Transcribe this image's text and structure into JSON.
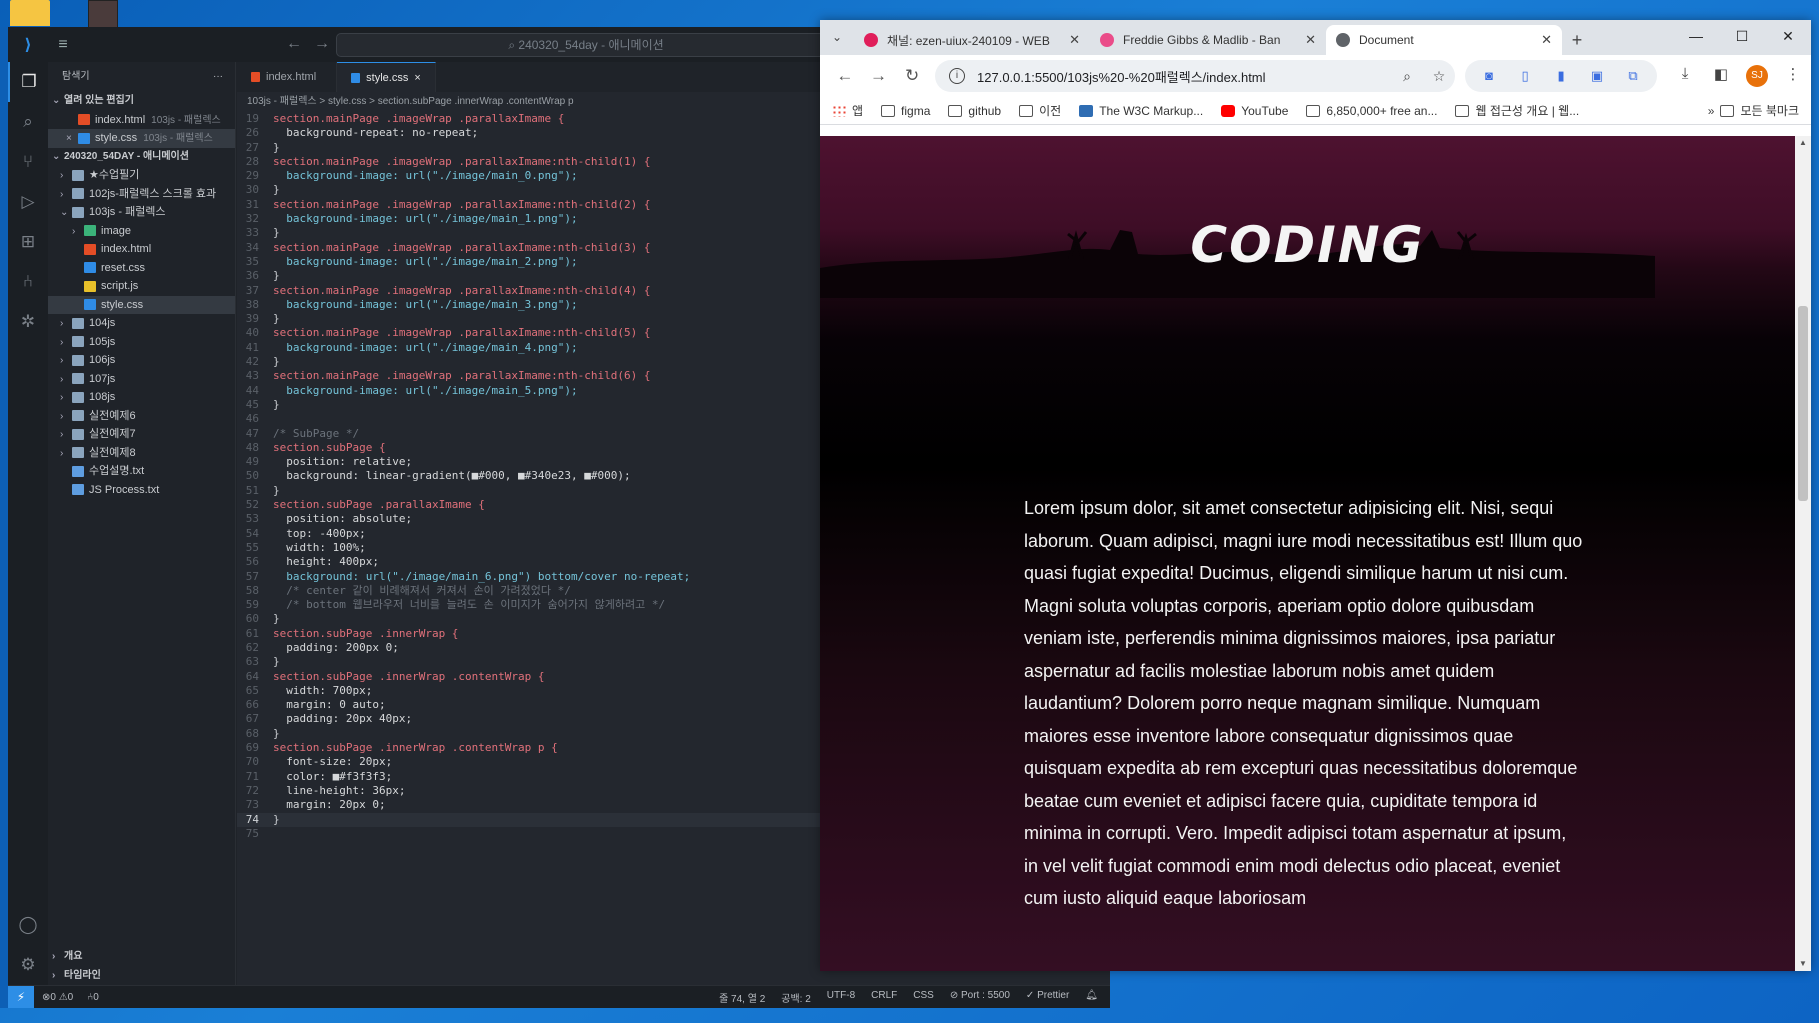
{
  "vscode": {
    "search_placeholder": "240320_54day - 애니메이션",
    "explorer_title": "탐색기",
    "explorer_more": "···",
    "open_editors_label": "열려 있는 편집기",
    "open_editors": [
      {
        "name": "index.html",
        "path": "103js - 패럴렉스",
        "type": "html",
        "close": ""
      },
      {
        "name": "style.css",
        "path": "103js - 패럴렉스",
        "type": "css",
        "close": "×"
      }
    ],
    "workspace_label": "240320_54DAY - 애니메이션",
    "tree": [
      {
        "chev": "›",
        "name": "★수업필기",
        "type": "folder",
        "indent": 1
      },
      {
        "chev": "›",
        "name": "102js-패럴렉스 스크롤 효과",
        "type": "folder",
        "indent": 1
      },
      {
        "chev": "⌄",
        "name": "103js - 패럴렉스",
        "type": "folder",
        "indent": 1
      },
      {
        "chev": "›",
        "name": "image",
        "type": "img",
        "indent": 2
      },
      {
        "chev": "",
        "name": "index.html",
        "type": "html",
        "indent": 2
      },
      {
        "chev": "",
        "name": "reset.css",
        "type": "css",
        "indent": 2
      },
      {
        "chev": "",
        "name": "script.js",
        "type": "js",
        "indent": 2
      },
      {
        "chev": "",
        "name": "style.css",
        "type": "css",
        "indent": 2,
        "selected": true
      },
      {
        "chev": "›",
        "name": "104js",
        "type": "folder",
        "indent": 1
      },
      {
        "chev": "›",
        "name": "105js",
        "type": "folder",
        "indent": 1
      },
      {
        "chev": "›",
        "name": "106js",
        "type": "folder",
        "indent": 1
      },
      {
        "chev": "›",
        "name": "107js",
        "type": "folder",
        "indent": 1
      },
      {
        "chev": "›",
        "name": "108js",
        "type": "folder",
        "indent": 1
      },
      {
        "chev": "›",
        "name": "실전예제6",
        "type": "folder",
        "indent": 1
      },
      {
        "chev": "›",
        "name": "실전예제7",
        "type": "folder",
        "indent": 1
      },
      {
        "chev": "›",
        "name": "실전예제8",
        "type": "folder",
        "indent": 1
      },
      {
        "chev": "",
        "name": "수업설명.txt",
        "type": "txt",
        "indent": 1
      },
      {
        "chev": "",
        "name": "JS Process.txt",
        "type": "txt",
        "indent": 1
      }
    ],
    "outline_label": "개요",
    "timeline_label": "타임라인",
    "tabs": [
      {
        "name": "index.html",
        "type": "html",
        "active": false,
        "close": ""
      },
      {
        "name": "style.css",
        "type": "css",
        "active": true,
        "close": "×"
      }
    ],
    "breadcrumb": "103js - 패럴렉스 > style.css > section.subPage .innerWrap .contentWrap p",
    "code_lines": [
      {
        "n": "19",
        "t": "section.mainPage .imageWrap .parallaxImame {",
        "k": "sel"
      },
      {
        "n": "26",
        "t": "  background-repeat: no-repeat;",
        "k": "prop"
      },
      {
        "n": "27",
        "t": "}",
        "k": "plain"
      },
      {
        "n": "28",
        "t": "section.mainPage .imageWrap .parallaxImame:nth-child(1) {",
        "k": "sel"
      },
      {
        "n": "29",
        "t": "  background-image: url(\"./image/main_0.png\");",
        "k": "url"
      },
      {
        "n": "30",
        "t": "}",
        "k": "plain"
      },
      {
        "n": "31",
        "t": "section.mainPage .imageWrap .parallaxImame:nth-child(2) {",
        "k": "sel"
      },
      {
        "n": "32",
        "t": "  background-image: url(\"./image/main_1.png\");",
        "k": "url"
      },
      {
        "n": "33",
        "t": "}",
        "k": "plain"
      },
      {
        "n": "34",
        "t": "section.mainPage .imageWrap .parallaxImame:nth-child(3) {",
        "k": "sel"
      },
      {
        "n": "35",
        "t": "  background-image: url(\"./image/main_2.png\");",
        "k": "url"
      },
      {
        "n": "36",
        "t": "}",
        "k": "plain"
      },
      {
        "n": "37",
        "t": "section.mainPage .imageWrap .parallaxImame:nth-child(4) {",
        "k": "sel"
      },
      {
        "n": "38",
        "t": "  background-image: url(\"./image/main_3.png\");",
        "k": "url"
      },
      {
        "n": "39",
        "t": "}",
        "k": "plain"
      },
      {
        "n": "40",
        "t": "section.mainPage .imageWrap .parallaxImame:nth-child(5) {",
        "k": "sel"
      },
      {
        "n": "41",
        "t": "  background-image: url(\"./image/main_4.png\");",
        "k": "url"
      },
      {
        "n": "42",
        "t": "}",
        "k": "plain"
      },
      {
        "n": "43",
        "t": "section.mainPage .imageWrap .parallaxImame:nth-child(6) {",
        "k": "sel"
      },
      {
        "n": "44",
        "t": "  background-image: url(\"./image/main_5.png\");",
        "k": "url"
      },
      {
        "n": "45",
        "t": "}",
        "k": "plain"
      },
      {
        "n": "46",
        "t": "",
        "k": "plain"
      },
      {
        "n": "47",
        "t": "/* SubPage */",
        "k": "cmt"
      },
      {
        "n": "48",
        "t": "section.subPage {",
        "k": "sel"
      },
      {
        "n": "49",
        "t": "  position: relative;",
        "k": "prop"
      },
      {
        "n": "50",
        "t": "  background: linear-gradient(■#000, ■#340e23, ■#000);",
        "k": "prop"
      },
      {
        "n": "51",
        "t": "}",
        "k": "plain"
      },
      {
        "n": "52",
        "t": "section.subPage .parallaxImame {",
        "k": "sel"
      },
      {
        "n": "53",
        "t": "  position: absolute;",
        "k": "prop"
      },
      {
        "n": "54",
        "t": "  top: -400px;",
        "k": "prop"
      },
      {
        "n": "55",
        "t": "  width: 100%;",
        "k": "prop"
      },
      {
        "n": "56",
        "t": "  height: 400px;",
        "k": "prop"
      },
      {
        "n": "57",
        "t": "  background: url(\"./image/main_6.png\") bottom/cover no-repeat;",
        "k": "url"
      },
      {
        "n": "58",
        "t": "  /* center 같이 비례해져서 커져서 손이 가려졌었다 */",
        "k": "cmt"
      },
      {
        "n": "59",
        "t": "  /* bottom 웹브라우저 너비를 늘려도 손 이미지가 숨어가지 않게하려고 */",
        "k": "cmt"
      },
      {
        "n": "60",
        "t": "}",
        "k": "plain"
      },
      {
        "n": "61",
        "t": "section.subPage .innerWrap {",
        "k": "sel"
      },
      {
        "n": "62",
        "t": "  padding: 200px 0;",
        "k": "prop"
      },
      {
        "n": "63",
        "t": "}",
        "k": "plain"
      },
      {
        "n": "64",
        "t": "section.subPage .innerWrap .contentWrap {",
        "k": "sel"
      },
      {
        "n": "65",
        "t": "  width: 700px;",
        "k": "prop"
      },
      {
        "n": "66",
        "t": "  margin: 0 auto;",
        "k": "prop"
      },
      {
        "n": "67",
        "t": "  padding: 20px 40px;",
        "k": "prop"
      },
      {
        "n": "68",
        "t": "}",
        "k": "plain"
      },
      {
        "n": "69",
        "t": "section.subPage .innerWrap .contentWrap p {",
        "k": "sel"
      },
      {
        "n": "70",
        "t": "  font-size: 20px;",
        "k": "prop"
      },
      {
        "n": "71",
        "t": "  color: ■#f3f3f3;",
        "k": "prop"
      },
      {
        "n": "72",
        "t": "  line-height: 36px;",
        "k": "prop"
      },
      {
        "n": "73",
        "t": "  margin: 20px 0;",
        "k": "prop"
      },
      {
        "n": "74",
        "t": "}",
        "k": "plain",
        "current": true
      },
      {
        "n": "75",
        "t": "",
        "k": "plain"
      }
    ],
    "status": {
      "errors": "⊗0 ⚠0",
      "ports": "⑃0",
      "position": "줄 74, 열 2",
      "spaces": "공백: 2",
      "encoding": "UTF-8",
      "eol": "CRLF",
      "language": "CSS",
      "port": "⊘ Port : 5500",
      "prettier": "✓ Prettier",
      "remote": "⚡"
    }
  },
  "chrome": {
    "tabs": [
      {
        "title": "채널: ezen-uiux-240109 - WEB",
        "color": "#e01e5a",
        "active": false
      },
      {
        "title": "Freddie Gibbs & Madlib - Ban",
        "color": "#ea4c89",
        "active": false
      },
      {
        "title": "Document",
        "color": "#5f6368",
        "active": true
      }
    ],
    "url": "127.0.0.1:5500/103js%20-%20패럴렉스/index.html",
    "bookmarks": [
      {
        "label": "앱",
        "icon": "apps"
      },
      {
        "label": "figma",
        "icon": "folder"
      },
      {
        "label": "github",
        "icon": "folder"
      },
      {
        "label": "이전",
        "icon": "folder"
      },
      {
        "label": "The W3C Markup...",
        "icon": "w3"
      },
      {
        "label": "YouTube",
        "icon": "yt"
      },
      {
        "label": "6,850,000+ free an...",
        "icon": "folder"
      },
      {
        "label": "웹 접근성 개요 | 웹...",
        "icon": "folder"
      }
    ],
    "bookmarks_more": "»",
    "all_bookmarks": "모든 북마크",
    "avatar": "SJ",
    "page": {
      "hero_title": "CODING",
      "paragraph": "Lorem ipsum dolor, sit amet consectetur adipisicing elit. Nisi, sequi laborum. Quam adipisci, magni iure modi necessitatibus est! Illum quo quasi fugiat expedita! Ducimus, eligendi similique harum ut nisi cum. Magni soluta voluptas corporis, aperiam optio dolore quibusdam veniam iste, perferendis minima dignissimos maiores, ipsa pariatur aspernatur ad facilis molestiae laborum nobis amet quidem laudantium? Dolorem porro neque magnam similique. Numquam maiores esse inventore labore consequatur dignissimos quae quisquam expedita ab rem excepturi quas necessitatibus doloremque beatae cum eveniet et adipisci facere quia, cupiditate tempora id minima in corrupti. Vero. Impedit adipisci totam aspernatur at ipsum, in vel velit fugiat commodi enim modi delectus odio placeat, eveniet cum iusto aliquid eaque laboriosam"
    }
  }
}
